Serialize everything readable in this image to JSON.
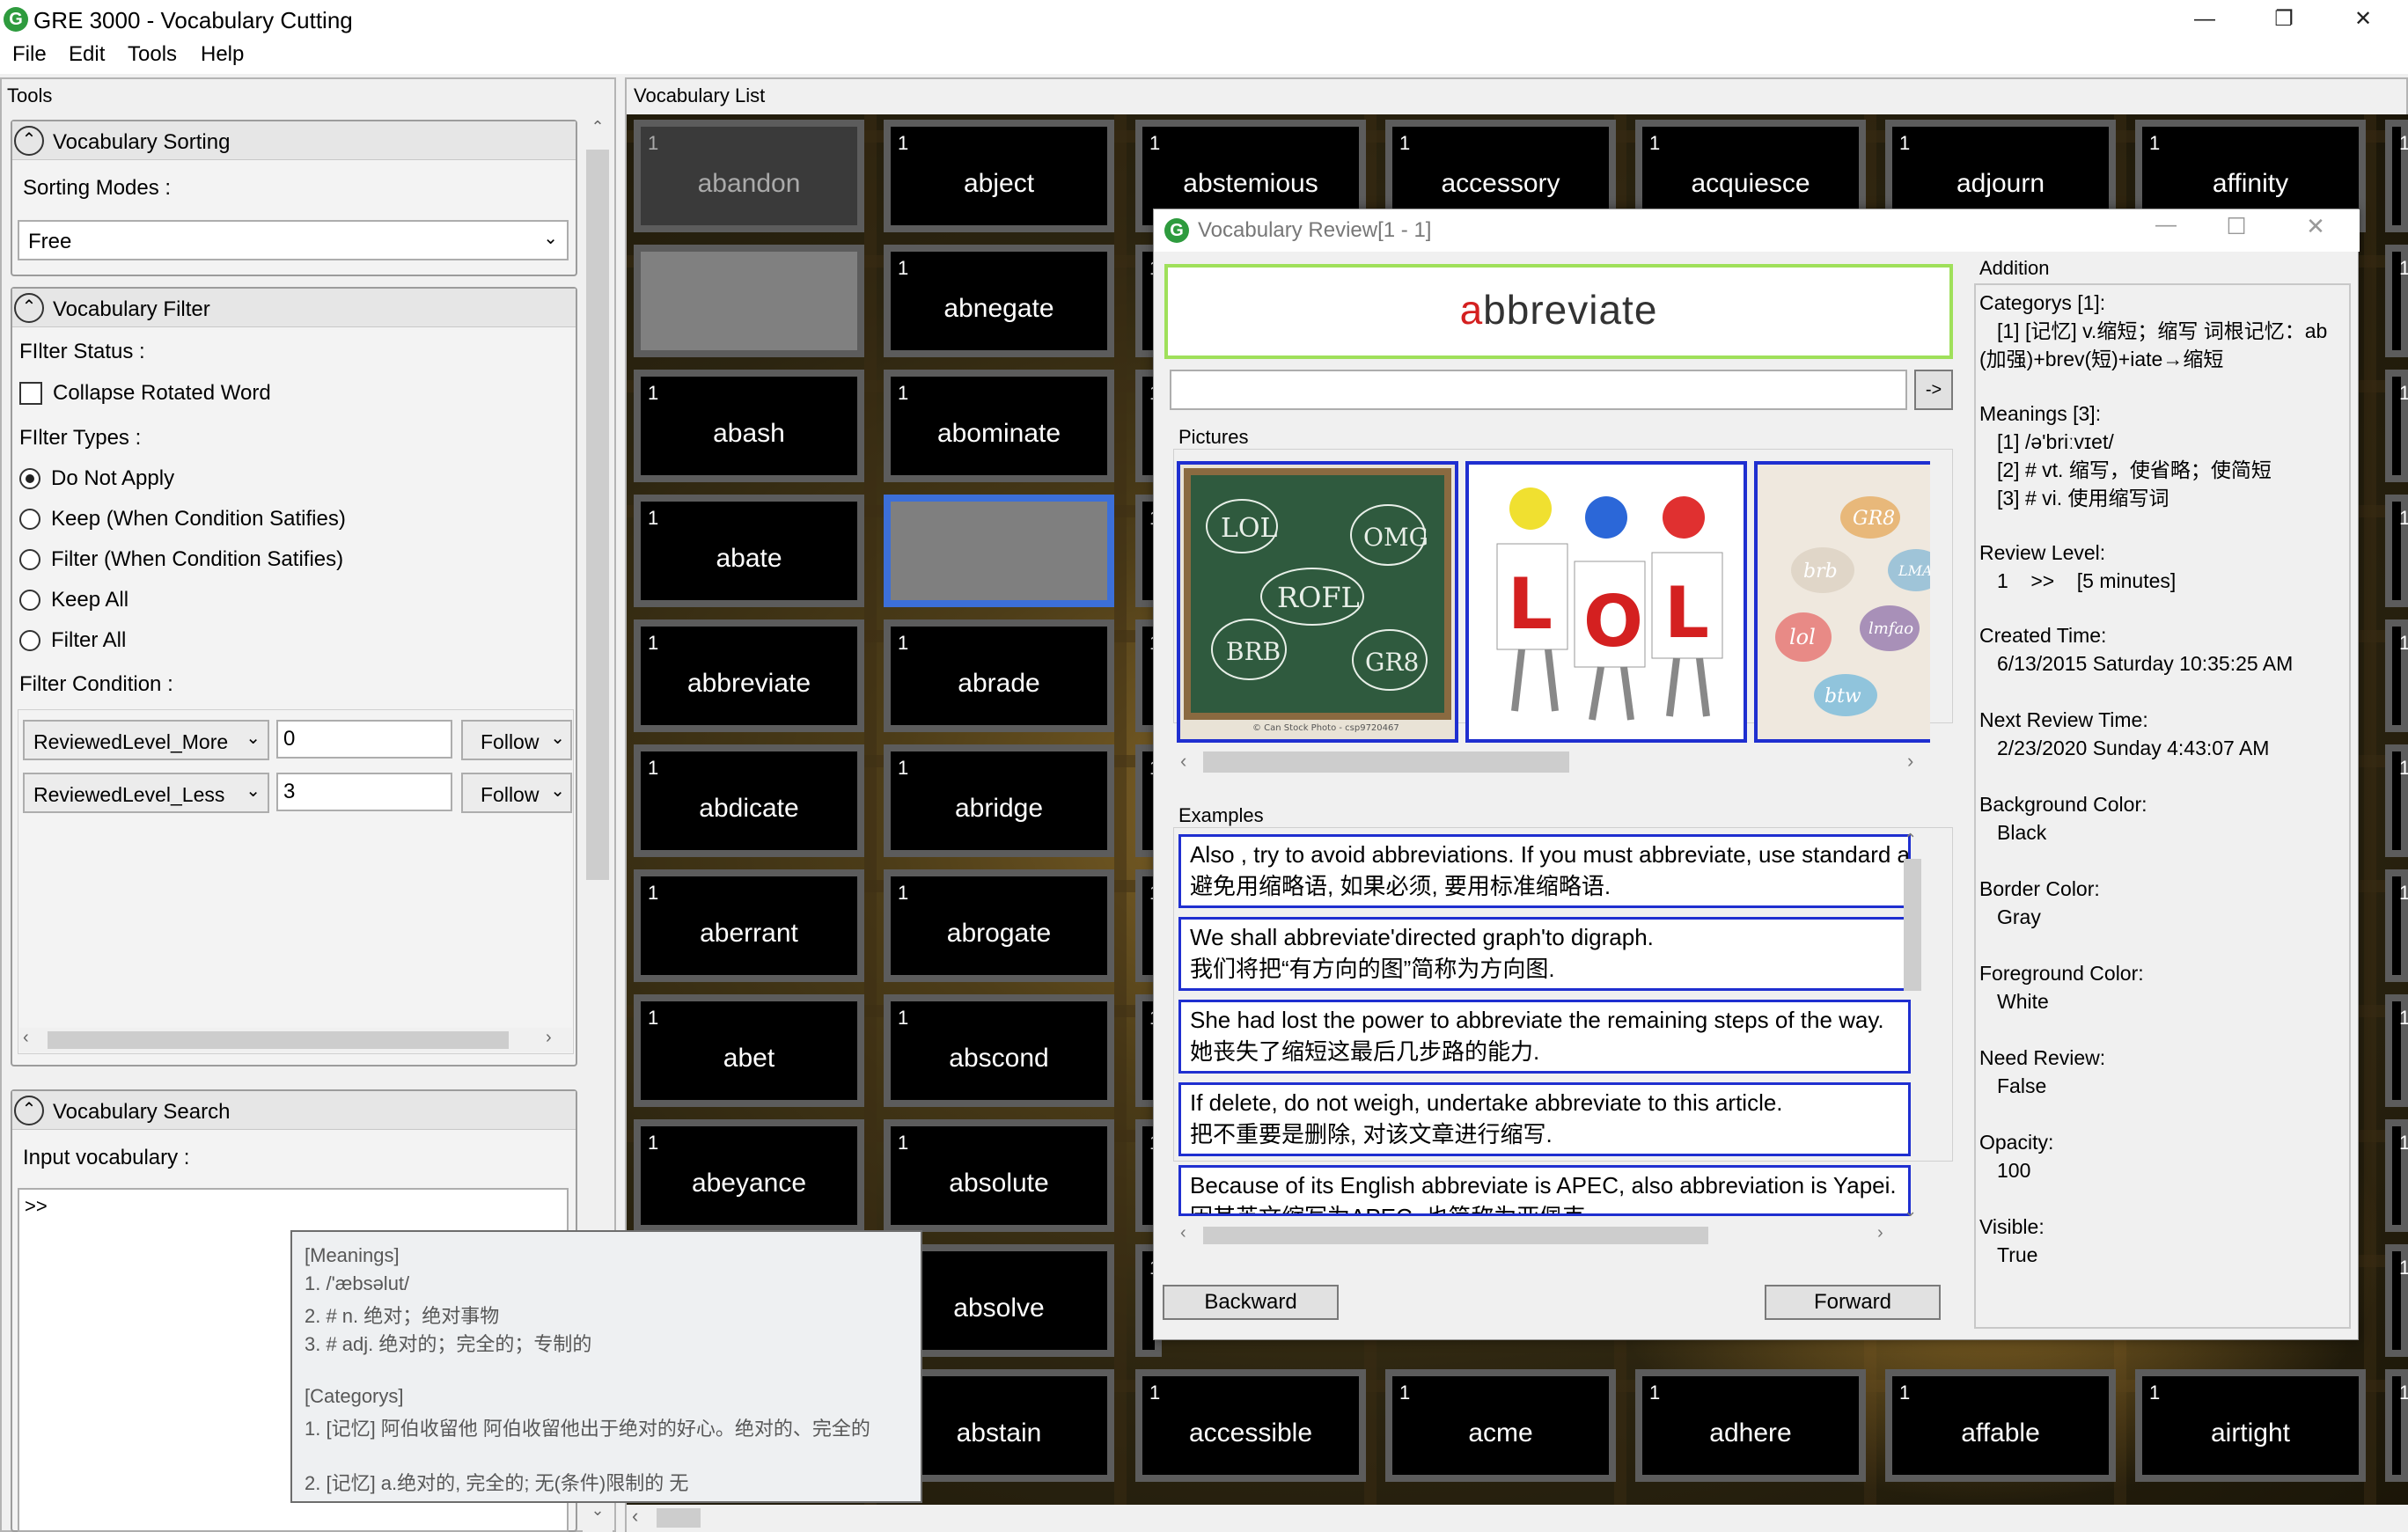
{
  "window": {
    "title": "GRE 3000 - Vocabulary Cutting",
    "app_icon": "G"
  },
  "menu": [
    "File",
    "Edit",
    "Tools",
    "Help"
  ],
  "tools_panel": {
    "header": "Tools",
    "sorting": {
      "title": "Vocabulary Sorting",
      "label": "Sorting Modes :",
      "value": "Free"
    },
    "filter": {
      "title": "Vocabulary Filter",
      "status_label": "FIlter Status :",
      "collapse_label": "Collapse Rotated Word",
      "types_label": "FIlter Types :",
      "options": [
        "Do Not Apply",
        "Keep (When Condition Satifies)",
        "Filter (When Condition Satifies)",
        "Keep All",
        "Filter All"
      ],
      "selected_option": 0,
      "condition_label": "Filter Condition :",
      "conditions": [
        {
          "field": "ReviewedLevel_More",
          "value": "0",
          "mode": "Follow"
        },
        {
          "field": "ReviewedLevel_Less",
          "value": "3",
          "mode": "Follow"
        }
      ]
    },
    "search": {
      "title": "Vocabulary Search",
      "label": "Input vocabulary :",
      "prompt": ">>"
    }
  },
  "vocab_panel": {
    "header": "Vocabulary List",
    "col1": [
      {
        "level": "1",
        "word": "abandon",
        "state": "dim"
      },
      {
        "level": "",
        "word": "",
        "state": "empty"
      },
      {
        "level": "1",
        "word": "abash",
        "state": ""
      },
      {
        "level": "1",
        "word": "abate",
        "state": ""
      },
      {
        "level": "1",
        "word": "abbreviate",
        "state": ""
      },
      {
        "level": "1",
        "word": "abdicate",
        "state": ""
      },
      {
        "level": "1",
        "word": "aberrant",
        "state": ""
      },
      {
        "level": "1",
        "word": "abet",
        "state": ""
      },
      {
        "level": "1",
        "word": "abeyance",
        "state": ""
      }
    ],
    "col2": [
      {
        "level": "1",
        "word": "abject",
        "state": ""
      },
      {
        "level": "1",
        "word": "abnegate",
        "state": ""
      },
      {
        "level": "1",
        "word": "abominate",
        "state": ""
      },
      {
        "level": "",
        "word": "",
        "state": "sel"
      },
      {
        "level": "1",
        "word": "abrade",
        "state": ""
      },
      {
        "level": "1",
        "word": "abridge",
        "state": ""
      },
      {
        "level": "1",
        "word": "abrogate",
        "state": ""
      },
      {
        "level": "1",
        "word": "abscond",
        "state": ""
      },
      {
        "level": "1",
        "word": "absolute",
        "state": ""
      },
      {
        "level": "",
        "word": "absolve",
        "state": ""
      },
      {
        "level": "",
        "word": "abstain",
        "state": ""
      }
    ],
    "top_row": [
      {
        "level": "1",
        "word": "abstemious"
      },
      {
        "level": "1",
        "word": "accessory"
      },
      {
        "level": "1",
        "word": "acquiesce"
      },
      {
        "level": "1",
        "word": "adjourn"
      },
      {
        "level": "1",
        "word": "affinity"
      }
    ],
    "bottom_row": [
      {
        "level": "1",
        "word": "accessible"
      },
      {
        "level": "1",
        "word": "acme"
      },
      {
        "level": "1",
        "word": "adhere"
      },
      {
        "level": "1",
        "word": "affable"
      },
      {
        "level": "1",
        "word": "airtight"
      }
    ],
    "edge_level": "1"
  },
  "review": {
    "title": "Vocabulary Review[1 - 1]",
    "word_first": "a",
    "word_rest": "bbreviate",
    "go_button": "->",
    "pictures_label": "Pictures",
    "pic1": {
      "words": [
        "LOL",
        "OMG",
        "ROFL",
        "BRB",
        "GR8"
      ],
      "credit": "© Can Stock Photo - csp9720467"
    },
    "pic2": {
      "letters": [
        "L",
        "O",
        "L"
      ]
    },
    "pic3": {
      "words": [
        "GR8",
        "LMAO",
        "lol",
        "btw",
        "brb",
        "lmfao"
      ]
    },
    "examples_label": "Examples",
    "examples": [
      {
        "en": " Also , try to avoid abbreviations. If you must abbreviate, use standard abbreviations.",
        "zh": "避免用缩略语, 如果必须, 要用标准缩略语."
      },
      {
        "en": "We shall abbreviate'directed graph'to digraph.",
        "zh": "我们将把“有方向的图”简称为方向图."
      },
      {
        "en": "She had lost the power to abbreviate the remaining steps of the way.",
        "zh": "她丧失了缩短这最后几步路的能力."
      },
      {
        "en": "If delete, do not weigh, undertake abbreviate to this article.",
        "zh": "把不重要是删除, 对该文章进行缩写."
      },
      {
        "en": "Because of its English abbreviate is APEC, also abbreviation is Yapei.",
        "zh": "因其英文缩写为APEC, 也简称为亚佩克."
      }
    ],
    "backward": "Backward",
    "forward": "Forward",
    "addition": {
      "header": "Addition",
      "categorys_label": "Categorys [1]:",
      "categorys_line1": "[1] [记忆] v.缩短；缩写 词根记忆：ab",
      "categorys_line2": "(加强)+brev(短)+iate→缩短",
      "meanings_label": "Meanings [3]:",
      "meanings": [
        "[1] /ə'briːvɪet/",
        "[2] # vt. 缩写，使省略；使简短",
        "[3] # vi. 使用缩写词"
      ],
      "review_level_label": "Review Level:",
      "review_level": "1    >>    [5 minutes]",
      "created_label": "Created Time:",
      "created": "6/13/2015 Saturday 10:35:25 AM",
      "next_label": "Next Review Time:",
      "next": "2/23/2020 Sunday 4:43:07 AM",
      "bg_label": "Background Color:",
      "bg": "Black",
      "border_label": "Border Color:",
      "border": "Gray",
      "fg_label": "Foreground Color:",
      "fg": "White",
      "need_label": "Need Review:",
      "need": "False",
      "opacity_label": "Opacity:",
      "opacity": "100",
      "visible_label": "Visible:",
      "visible": "True"
    }
  },
  "tooltip": {
    "meanings_header": "[Meanings]",
    "m1": "1. /'æbsəlut/",
    "m2": "2. # n. 绝对；绝对事物",
    "m3": "3. # adj. 绝对的；完全的；专制的",
    "categorys_header": "[Categorys]",
    "c1": "1. [记忆] 阿伯收留他 阿伯收留他出于绝对的好心。绝对的、完全的",
    "c2": "2. [记忆] a.绝对的,   完全的; 无(条件)限制的 无"
  },
  "colors": {
    "accent_green": "#9fe05a",
    "picture_border": "#1f2fd0",
    "word_highlight": "#d42020",
    "selection_border": "#3c6fd8"
  }
}
